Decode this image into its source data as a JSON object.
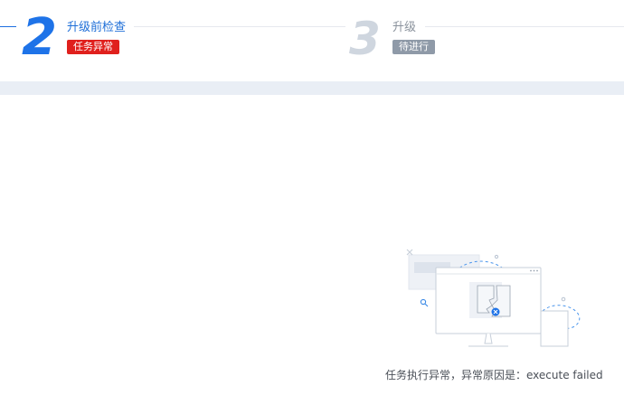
{
  "steps": [
    {
      "number": "2",
      "title": "升级前检查",
      "status": "任务异常",
      "state": "active",
      "status_color": "#e0201d"
    },
    {
      "number": "3",
      "title": "升级",
      "status": "待进行",
      "state": "pending",
      "status_color": "#8f9aa8"
    }
  ],
  "result": {
    "message": "任务执行异常，异常原因是：execute failed",
    "icon": "broken-document-monitor-illustration"
  },
  "colors": {
    "primary": "#1e73e8",
    "error": "#e0201d",
    "pending": "#cfd6df"
  }
}
